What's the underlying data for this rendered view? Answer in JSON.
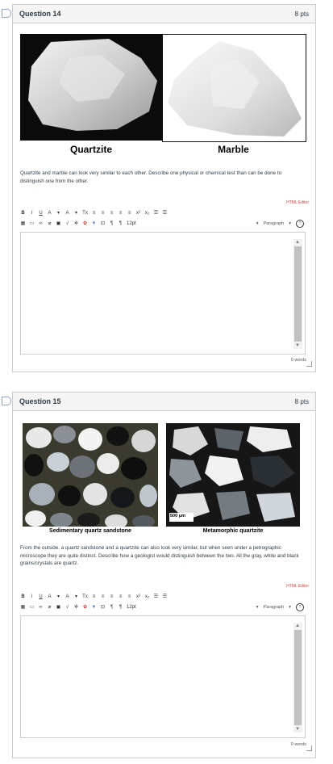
{
  "questions": [
    {
      "title": "Question 14",
      "points": "8 pts",
      "left_caption": "Quartzite",
      "right_caption": "Marble",
      "prompt": "Quartzite and marble can look very similar to each other. Describe one physical or chemical test than can be done to distinguish one from the other.",
      "html_editor_label": "HTML Editor",
      "font_size": "12pt",
      "paragraph": "Paragraph",
      "word_count": "0 words"
    },
    {
      "title": "Question 15",
      "points": "8 pts",
      "left_caption": "Sedimentary quartz sandstone",
      "right_caption": "Metamorphic quartzite",
      "scale_label": "500 μm",
      "prompt": "From the outside, a quartz sandstone and a quartzite can also look very similar, but when seen under a petrographic microscope they are quite distinct. Describe how a geologist would distinguish between the two. All the gray, white and black grains/crystals are quartz.",
      "html_editor_label": "HTML Editor",
      "font_size": "12pt",
      "paragraph": "Paragraph",
      "word_count": "0 words"
    }
  ],
  "toolbar": {
    "bold": "B",
    "italic": "I",
    "underline": "U",
    "font_color": "A",
    "bg_color": "A",
    "clear": "Tx",
    "superscript": "x²",
    "subscript": "x₂",
    "help": "?"
  }
}
